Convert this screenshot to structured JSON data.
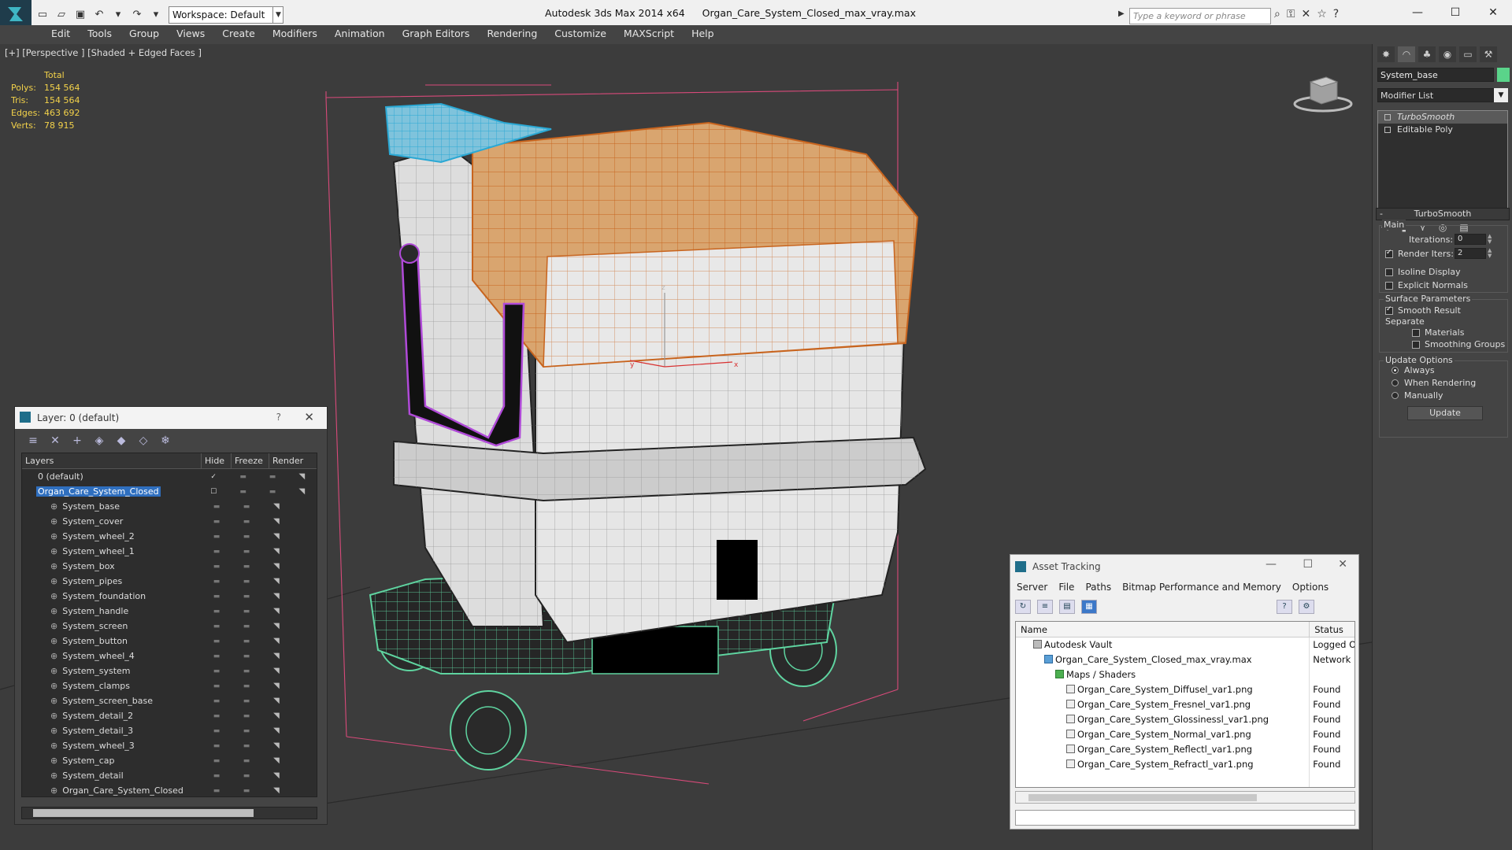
{
  "titlebar": {
    "workspace": "Workspace: Default",
    "app_name": "Autodesk 3ds Max  2014 x64",
    "file_name": "Organ_Care_System_Closed_max_vray.max",
    "search_placeholder": "Type a keyword or phrase"
  },
  "menus": [
    "Edit",
    "Tools",
    "Group",
    "Views",
    "Create",
    "Modifiers",
    "Animation",
    "Graph Editors",
    "Rendering",
    "Customize",
    "MAXScript",
    "Help"
  ],
  "viewport": {
    "label": "[+] [Perspective ] [Shaded + Edged Faces ]",
    "stats": {
      "header": "Total",
      "rows": [
        {
          "key": "Polys:",
          "value": "154 564"
        },
        {
          "key": "Tris:",
          "value": "154 564"
        },
        {
          "key": "Edges:",
          "value": "463 692"
        },
        {
          "key": "Verts:",
          "value": "78 915"
        }
      ]
    },
    "axis": {
      "z": "z",
      "x": "x",
      "y": "y"
    }
  },
  "layer_explorer": {
    "title": "Layer: 0 (default)",
    "help": "?",
    "columns": {
      "layers": "Layers",
      "hide": "Hide",
      "freeze": "Freeze",
      "render": "Render"
    },
    "default_layer": "0 (default)",
    "selected_layer": "Organ_Care_System_Closed",
    "objects": [
      "System_base",
      "System_cover",
      "System_wheel_2",
      "System_wheel_1",
      "System_box",
      "System_pipes",
      "System_foundation",
      "System_handle",
      "System_screen",
      "System_button",
      "System_wheel_4",
      "System_system",
      "System_clamps",
      "System_screen_base",
      "System_detail_2",
      "System_detail_3",
      "System_wheel_3",
      "System_cap",
      "System_detail",
      "Organ_Care_System_Closed"
    ]
  },
  "asset_tracking": {
    "title": "Asset Tracking",
    "menus": [
      "Server",
      "File",
      "Paths",
      "Bitmap Performance and Memory",
      "Options"
    ],
    "columns": {
      "name": "Name",
      "status": "Status"
    },
    "rows": [
      {
        "name": "Autodesk Vault",
        "status": "Logged O",
        "indent": 0,
        "icon": "vault"
      },
      {
        "name": "Organ_Care_System_Closed_max_vray.max",
        "status": "Network P",
        "indent": 1,
        "icon": "max"
      },
      {
        "name": "Maps / Shaders",
        "status": "",
        "indent": 2,
        "icon": "folder"
      },
      {
        "name": "Organ_Care_System_Diffusel_var1.png",
        "status": "Found",
        "indent": 3,
        "icon": "file"
      },
      {
        "name": "Organ_Care_System_Fresnel_var1.png",
        "status": "Found",
        "indent": 3,
        "icon": "file"
      },
      {
        "name": "Organ_Care_System_Glossinessl_var1.png",
        "status": "Found",
        "indent": 3,
        "icon": "file"
      },
      {
        "name": "Organ_Care_System_Normal_var1.png",
        "status": "Found",
        "indent": 3,
        "icon": "file"
      },
      {
        "name": "Organ_Care_System_Reflectl_var1.png",
        "status": "Found",
        "indent": 3,
        "icon": "file"
      },
      {
        "name": "Organ_Care_System_Refractl_var1.png",
        "status": "Found",
        "indent": 3,
        "icon": "file"
      }
    ]
  },
  "command_panel": {
    "object_name": "System_base",
    "object_color": "#5ad48a",
    "modifier_list": "Modifier List",
    "stack": [
      "TurboSmooth",
      "Editable Poly"
    ],
    "turbosmooth": {
      "title": "TurboSmooth",
      "main": "Main",
      "iterations_label": "Iterations:",
      "iterations": "0",
      "render_iters_label": "Render Iters:",
      "render_iters": "2",
      "render_iters_checked": true,
      "isoline": "Isoline Display",
      "explicit_normals": "Explicit Normals",
      "surface_params": "Surface Parameters",
      "smooth_result": "Smooth Result",
      "separate": "Separate",
      "materials": "Materials",
      "smoothing_groups": "Smoothing Groups",
      "update_options": "Update Options",
      "always": "Always",
      "when_rendering": "When Rendering",
      "manually": "Manually",
      "update_button": "Update"
    }
  }
}
